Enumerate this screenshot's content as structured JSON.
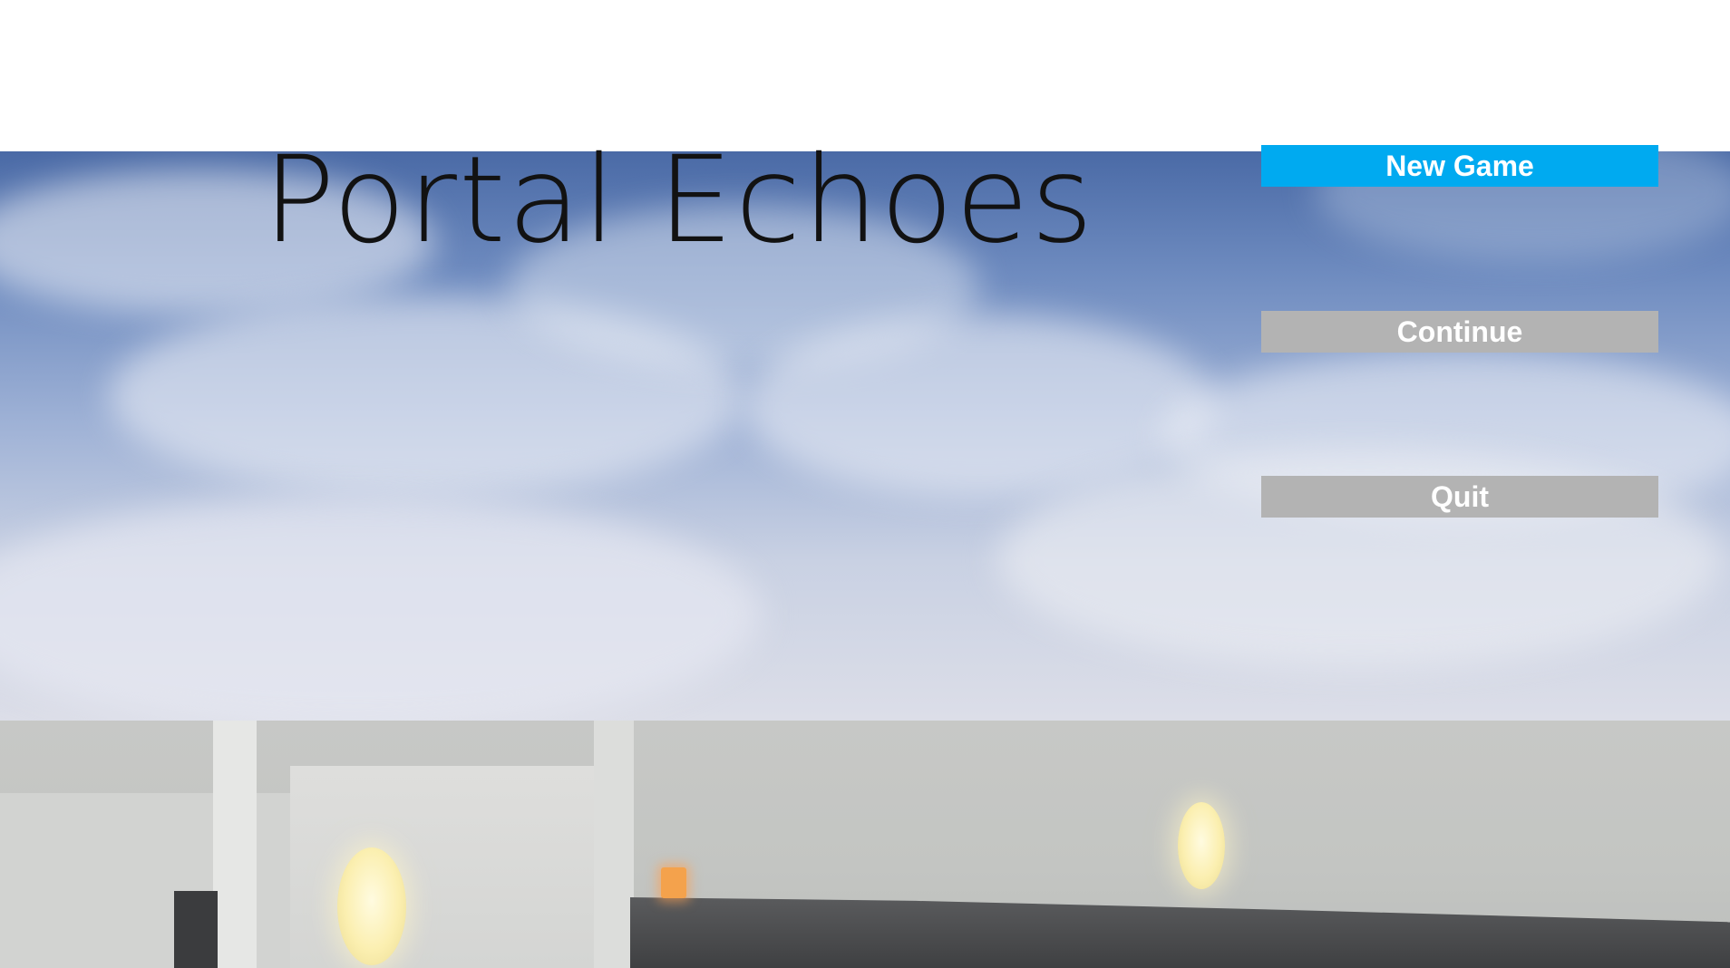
{
  "game": {
    "title": "Portal Echoes"
  },
  "menu": {
    "items": [
      {
        "label": "New Game",
        "state": "highlighted",
        "color": "#00aaf0"
      },
      {
        "label": "Continue",
        "state": "normal",
        "color": "#b3b3b3"
      },
      {
        "label": "Quit",
        "state": "normal",
        "color": "#b3b3b3"
      }
    ]
  },
  "colors": {
    "highlight": "#00aaf0",
    "button_normal": "#b3b3b3",
    "title_text": "#121212",
    "button_text": "#ffffff"
  }
}
